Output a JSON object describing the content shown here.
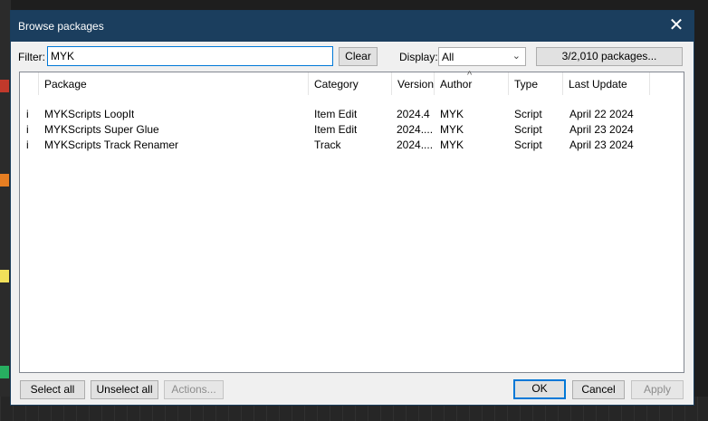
{
  "dialog": {
    "title": "Browse packages"
  },
  "filter": {
    "label": "Filter:",
    "value": "MYK",
    "clear_label": "Clear"
  },
  "display": {
    "label": "Display:",
    "selected": "All",
    "count_button": "3/2,010 packages..."
  },
  "table": {
    "columns": [
      "Package",
      "Category",
      "Version",
      "Author",
      "Type",
      "Last Update"
    ],
    "rows": [
      {
        "flag": "i",
        "package": "MYKScripts LoopIt",
        "category": "Item Edit",
        "version": "2024.4",
        "author": "MYK",
        "type": "Script",
        "last_update": "April 22 2024"
      },
      {
        "flag": "i",
        "package": "MYKScripts Super Glue",
        "category": "Item Edit",
        "version": "2024....",
        "author": "MYK",
        "type": "Script",
        "last_update": "April 23 2024"
      },
      {
        "flag": "i",
        "package": "MYKScripts Track Renamer",
        "category": "Track",
        "version": "2024....",
        "author": "MYK",
        "type": "Script",
        "last_update": "April 23 2024"
      }
    ]
  },
  "buttons": {
    "select_all": "Select all",
    "unselect_all": "Unselect all",
    "actions": "Actions...",
    "ok": "OK",
    "cancel": "Cancel",
    "apply": "Apply"
  },
  "colors": {
    "titlebar": "#1b3e5e",
    "accent": "#0078d7"
  }
}
